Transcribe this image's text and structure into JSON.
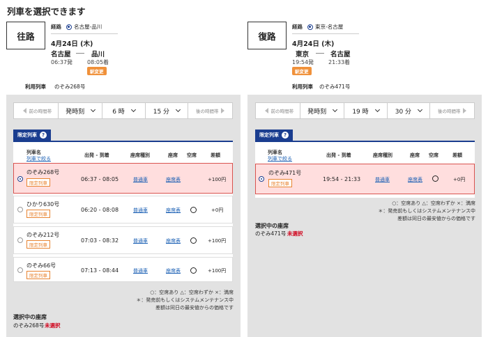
{
  "page_title": "列車を選択できます",
  "outbound": {
    "direction": "往路",
    "route_label": "経路",
    "route_name": "名古屋-品川",
    "date": "4月24日 (木)",
    "from_station": "名古屋",
    "to_station": "品川",
    "depart_time": "06:37発",
    "arrive_time": "08:05着",
    "badge": "駅変更",
    "train_label": "利用列車",
    "train_name": "のぞみ268号",
    "nav": {
      "prev": "前の時間帯",
      "mode": "発時刻",
      "hour": "6 時",
      "minute": "15 分",
      "next": "後の時間帯"
    },
    "tab_label": "限定列車",
    "headers": {
      "name": "列車名",
      "filter": "列車で絞る",
      "times": "出発 - 到着",
      "seat_type": "座席種別",
      "seat": "座席",
      "vacancy": "空席",
      "diff": "差額"
    },
    "rows": [
      {
        "name": "のぞみ268号",
        "tag": "限定列車",
        "times": "06:37 - 08:05",
        "seat_type": "普通車",
        "seat": "座席表",
        "vacancy": "",
        "diff": "+100円",
        "selected": true
      },
      {
        "name": "ひかり630号",
        "tag": "限定列車",
        "times": "06:20 - 08:08",
        "seat_type": "普通車",
        "seat": "座席表",
        "vacancy": "○",
        "diff": "+0円",
        "selected": false
      },
      {
        "name": "のぞみ212号",
        "tag": "限定列車",
        "times": "07:03 - 08:32",
        "seat_type": "普通車",
        "seat": "座席表",
        "vacancy": "○",
        "diff": "+100円",
        "selected": false
      },
      {
        "name": "のぞみ66号",
        "tag": "限定列車",
        "times": "07:13 - 08:44",
        "seat_type": "普通車",
        "seat": "座席表",
        "vacancy": "○",
        "diff": "+100円",
        "selected": false
      }
    ],
    "legend": "○：空席あり △：空席わずか ×：満席",
    "note1": "＊：発売前もしくはシステムメンテナンス中",
    "note2": "差額は同日の最安値からの価格です",
    "selected_seat_title": "選択中の座席",
    "selected_seat_train": "のぞみ268号",
    "selected_seat_status": "未選択"
  },
  "inbound": {
    "direction": "復路",
    "route_label": "経路",
    "route_name": "東京-名古屋",
    "date": "4月24日 (木)",
    "from_station": "東京",
    "to_station": "名古屋",
    "depart_time": "19:54発",
    "arrive_time": "21:33着",
    "badge": "駅変更",
    "train_label": "利用列車",
    "train_name": "のぞみ471号",
    "nav": {
      "prev": "前の時間帯",
      "mode": "発時刻",
      "hour": "19 時",
      "minute": "30 分",
      "next": "後の時間帯"
    },
    "tab_label": "限定列車",
    "headers": {
      "name": "列車名",
      "filter": "列車で絞る",
      "times": "出発 - 到着",
      "seat_type": "座席種別",
      "seat": "座席",
      "vacancy": "空席",
      "diff": "差額"
    },
    "rows": [
      {
        "name": "のぞみ471号",
        "tag": "限定列車",
        "times": "19:54 - 21:33",
        "seat_type": "普通車",
        "seat": "座席表",
        "vacancy": "○",
        "diff": "+0円",
        "selected": true
      }
    ],
    "legend": "○：空席あり △：空席わずか ×：満席",
    "note1": "＊：発売前もしくはシステムメンテナンス中",
    "note2": "差額は同日の最安値からの価格です",
    "selected_seat_title": "選択中の座席",
    "selected_seat_train": "のぞみ471号",
    "selected_seat_status": "未選択"
  }
}
